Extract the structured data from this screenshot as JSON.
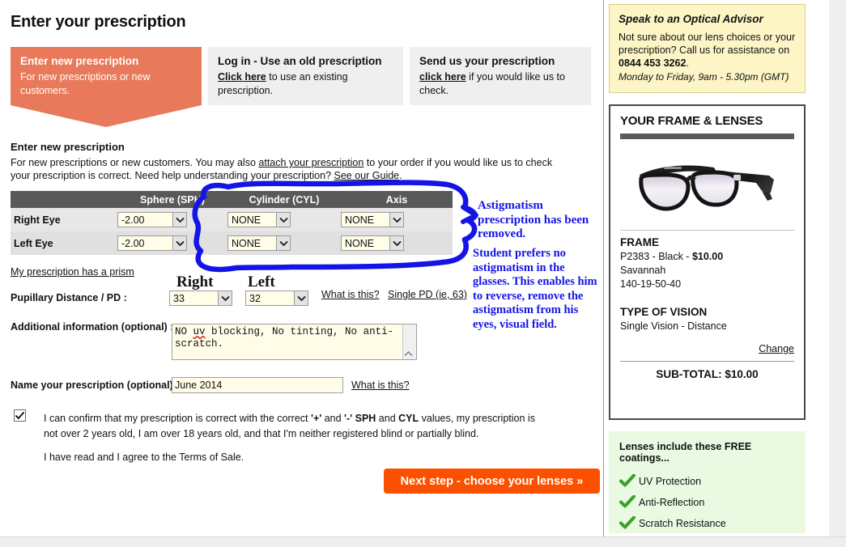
{
  "page": {
    "title": "Enter your prescription"
  },
  "tabs": [
    {
      "title": "Enter new prescription",
      "sub": "For new prescriptions or new customers.",
      "active": true
    },
    {
      "title": "Log in - Use an old prescription",
      "link": "Click here",
      "sub_rest": " to use an existing prescription."
    },
    {
      "title": "Send us your prescription",
      "link": "click here",
      "sub_rest": " if you would like us to check."
    }
  ],
  "intro": {
    "heading": "Enter new prescription",
    "part1": "For new prescriptions or new customers. You may also ",
    "link1": "attach your prescription",
    "part2": " to your order if you would like us to check your prescription is correct. Need help understanding your prescription? ",
    "link2": "See our Guide",
    "part3": "."
  },
  "rx_table": {
    "headers": [
      "",
      "Sphere (SPH)",
      "Cylinder (CYL)",
      "Axis"
    ],
    "rows": [
      {
        "eye": "Right Eye",
        "sph": "-2.00",
        "cyl": "NONE",
        "axis": "NONE"
      },
      {
        "eye": "Left Eye",
        "sph": "-2.00",
        "cyl": "NONE",
        "axis": "NONE"
      }
    ]
  },
  "prism_link": "My prescription has a prism",
  "pd": {
    "right_label": "Right",
    "left_label": "Left",
    "row_label": "Pupillary Distance / PD :",
    "right_value": "33",
    "left_value": "32",
    "link_what": "What is this?",
    "link_single": "Single PD (ie, 63)"
  },
  "additional": {
    "label": "Additional information (optional) :",
    "value_pre": "NO ",
    "value_misspelled": "uv",
    "value_post": " blocking, No tinting, No anti-scratch."
  },
  "name_field": {
    "label": "Name your prescription (optional) :",
    "value": "June 2014",
    "link": "What is this?"
  },
  "confirm": {
    "checked": true,
    "text_a": "I can confirm that my prescription is correct with the correct  ",
    "plus": "'+'",
    "text_b": " and ",
    "minus": "'-'",
    "sph": " SPH",
    "text_c": " and ",
    "cyl": "CYL",
    "text_d": " values, my prescription is not over 2 years old, I am over 18 years old, and that I'm neither registered blind or partially blind.",
    "terms": "I have read and I agree to the Terms of Sale."
  },
  "next_button": {
    "label": "Next step - choose your lenses »"
  },
  "annotations": {
    "note_1": "Astigmatism prescription has been removed.",
    "note_2": "Student prefers no astigmatism in the glasses. This enables him to reverse, remove the astigmatism from his eyes, visual field.",
    "ink_color": "#1414e6"
  },
  "advisor": {
    "heading": "Speak to an Optical Advisor",
    "body_a": "Not sure about our lens choices or your prescription? Call us for assistance on ",
    "phone": "0844 453 3262",
    "body_b": ".",
    "hours": "Monday to Friday, 9am - 5.30pm (GMT)"
  },
  "frame_panel": {
    "title": "YOUR FRAME & LENSES",
    "frame_heading": "FRAME",
    "frame_line1_a": "P2383 - Black - ",
    "frame_line1_price": "$10.00",
    "frame_line2": "Savannah",
    "frame_line3": "140-19-50-40",
    "vision_heading": "TYPE OF VISION",
    "vision_value": "Single Vision - Distance",
    "change_link": "Change",
    "subtotal": "SUB-TOTAL: $10.00"
  },
  "coatings": {
    "heading": "Lenses include these FREE coatings...",
    "items": [
      "UV Protection",
      "Anti-Reflection",
      "Scratch Resistance"
    ]
  },
  "colors": {
    "tab_active": "#e8795a",
    "button": "#fa5000",
    "table_header": "#595959",
    "advisor_bg": "#fdf5c6",
    "coatings_bg": "#e9f9e2",
    "input_bg": "#fffce8",
    "annotation": "#1414e6",
    "tick_green": "#3aa02a"
  }
}
